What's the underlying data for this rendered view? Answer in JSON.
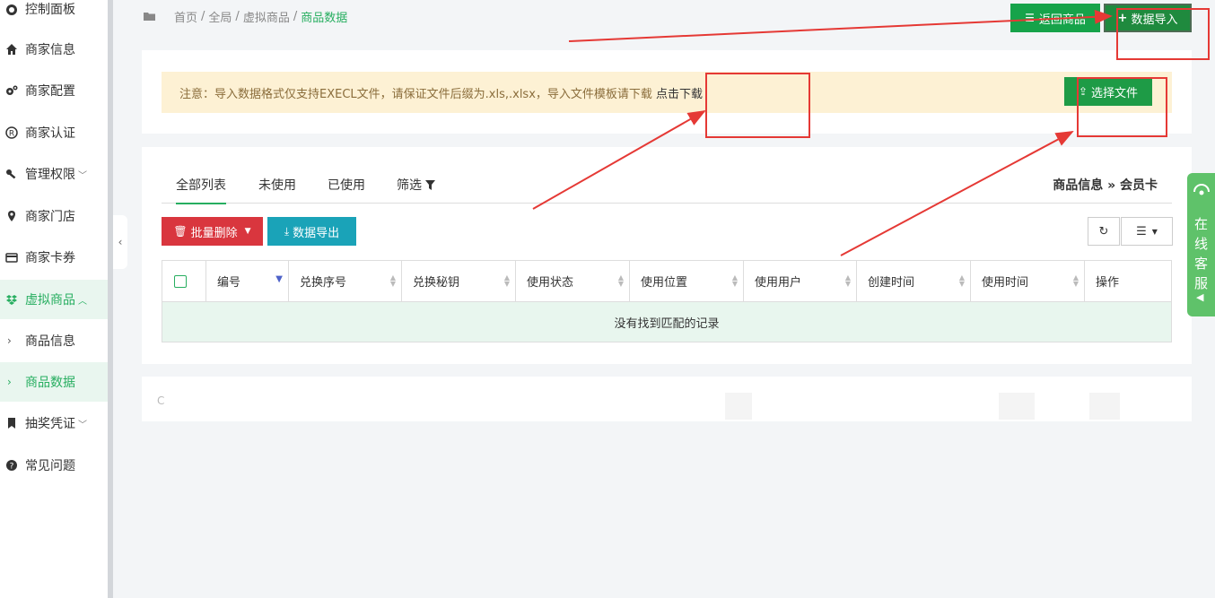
{
  "sidebar": {
    "items": [
      {
        "label": "控制面板",
        "icon": "dashboard-icon"
      },
      {
        "label": "商家信息",
        "icon": "home-icon"
      },
      {
        "label": "商家配置",
        "icon": "cogs-icon"
      },
      {
        "label": "商家认证",
        "icon": "registered-icon"
      },
      {
        "label": "管理权限",
        "icon": "key-icon",
        "caret": "﹀"
      },
      {
        "label": "商家门店",
        "icon": "map-marker-icon"
      },
      {
        "label": "商家卡券",
        "icon": "credit-card-icon"
      },
      {
        "label": "虚拟商品",
        "icon": "dropbox-icon",
        "caret": "︿"
      },
      {
        "label": "商品信息",
        "icon": "chevron-right-icon"
      },
      {
        "label": "商品数据",
        "icon": "chevron-right-icon"
      },
      {
        "label": "抽奖凭证",
        "icon": "bookmark-icon",
        "caret": "﹀"
      },
      {
        "label": "常见问题",
        "icon": "question-circle-icon"
      }
    ],
    "collapse_glyph": "‹"
  },
  "breadcrumb": {
    "home": "首页",
    "sep": "/",
    "level1": "全局",
    "level2": "虚拟商品",
    "current": "商品数据"
  },
  "top_buttons": {
    "back": "返回商品",
    "import": "数据导入"
  },
  "notice": {
    "text": "注意：导入数据格式仅支持EXECL文件，请保证文件后缀为.xls,.xlsx，导入文件模板请下载",
    "link": "点击下载",
    "choose_file": "选择文件"
  },
  "tabs": {
    "all": "全部列表",
    "unused": "未使用",
    "used": "已使用",
    "filter": "筛选"
  },
  "right_crumb": "商品信息 » 会员卡",
  "toolbar": {
    "batch_delete": "批量删除",
    "export": "数据导出"
  },
  "table": {
    "columns": [
      "编号",
      "兑换序号",
      "兑换秘钥",
      "使用状态",
      "使用位置",
      "使用用户",
      "创建时间",
      "使用时间",
      "操作"
    ],
    "empty": "没有找到匹配的记录"
  },
  "footer_fragment": "C",
  "chat": {
    "label": "在线客服"
  },
  "colors": {
    "accent": "#27ae60",
    "danger": "#d9363e",
    "info": "#1aa3b8",
    "annotation": "#e53935"
  }
}
